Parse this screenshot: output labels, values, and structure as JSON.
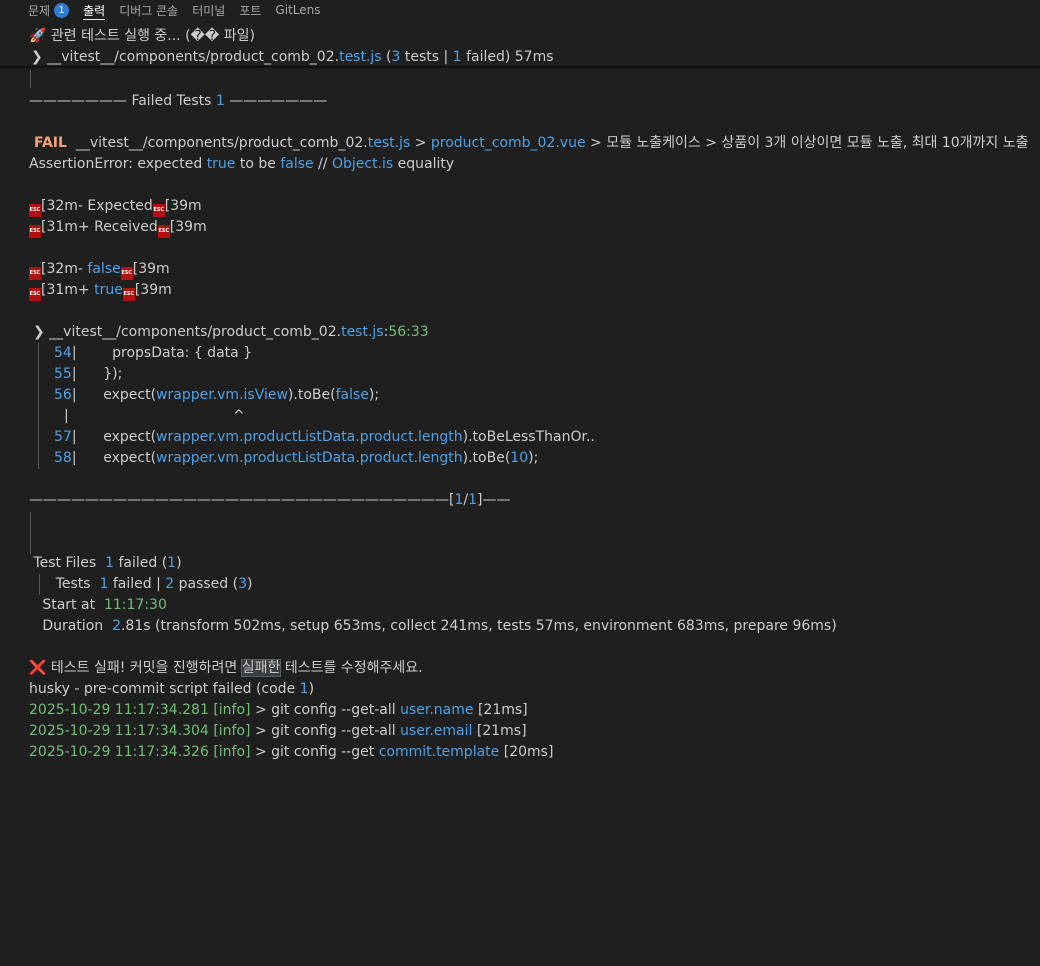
{
  "tabs": [
    {
      "label": "문제",
      "badge": "1"
    },
    {
      "label": "출력"
    },
    {
      "label": "디버그 콘솔"
    },
    {
      "label": "터미널"
    },
    {
      "label": "포트"
    },
    {
      "label": "GitLens"
    }
  ],
  "header": {
    "rocket": "🚀",
    "running": "관련 테스트 실행 중... (�� 파일)",
    "chevron": "❯",
    "file_prefix": "__vitest__/components/product_comb_02.",
    "file_ext": "test.js",
    "open_paren": " (",
    "tests_num": "3",
    "tests_mid": " tests | ",
    "failed_num": "1",
    "tail": " failed) 57ms"
  },
  "failed_header": {
    "left": "——————— Failed Tests ",
    "count": "1",
    "right": " ———————"
  },
  "fail_line": {
    "tag": "FAIL",
    "path": "  __vitest__/components/product_comb_02.",
    "ext": "test.js",
    "sep1": " > ",
    "vue": "product_comb_02.vue",
    "rest": " > 모듈 노출케이스 > 상품이 3개 이상이면 모듈 노출, 최대 10개까지 노출"
  },
  "assertion": {
    "a": "AssertionError: expected ",
    "b": "true",
    "c": " to be ",
    "d": "false",
    "e": " // ",
    "f": "Object.is",
    "g": " equality"
  },
  "esc_glyph": "ESC",
  "diff": {
    "l1a": "[32m- Expected",
    "l1b": "[39m",
    "l2a": "[31m+ Received",
    "l2b": "[39m",
    "l3a": "[32m- ",
    "l3v": "false",
    "l3b": "[39m",
    "l4a": "[31m+ ",
    "l4v": "true",
    "l4b": "[39m"
  },
  "location": {
    "chevron": "❯",
    "path": " __vitest__/components/product_comb_02.",
    "ext": "test.js",
    "colon": ":",
    "pos": "56:33"
  },
  "code": [
    {
      "num": "54",
      "text": "|        propsData: { data }"
    },
    {
      "num": "55",
      "text": "|      });"
    },
    {
      "num": "56",
      "pre": "|      expect(",
      "call": "wrapper.vm.isView",
      "mid": ").toBe(",
      "arg": "false",
      "post": ");"
    },
    {
      "caret_bar": "|",
      "caret": "^"
    },
    {
      "num": "57",
      "pre": "|      expect(",
      "call": "wrapper.vm.productListData.product.length",
      "post": ").toBeLessThanOr.."
    },
    {
      "num": "58",
      "pre": "|      expect(",
      "call": "wrapper.vm.productListData.product.length",
      "mid": ").toBe(",
      "arg": "10",
      "post": ");"
    }
  ],
  "separator": {
    "line": "——————————————————————————————[",
    "page": "1",
    "slash": "/",
    "total": "1",
    "end": "]——"
  },
  "summary": {
    "files_label": " Test Files  ",
    "files_failed": "1",
    "files_failed_txt": " failed (",
    "files_total": "1",
    "close": ")",
    "tests_label": "      Tests  ",
    "tests_failed": "1",
    "tests_mid": " failed | ",
    "tests_passed": "2",
    "tests_passed_txt": " passed (",
    "tests_total": "3",
    "start_label": "   Start at  ",
    "start_time": "11:17:30",
    "duration_label": "   Duration  ",
    "duration_num": "2",
    "duration_rest": ".81s (transform 502ms, setup 653ms, collect 241ms, tests 57ms, environment 683ms, prepare 96ms)"
  },
  "message": {
    "cross": "❌",
    "a": " 테스트 실패! 커밋을 진행하려면 ",
    "hl": "실패한",
    "b": " 테스트를 수정해주세요."
  },
  "husky": {
    "a": "husky - pre-commit script failed (code ",
    "code": "1",
    "b": ")"
  },
  "logs": [
    {
      "time": "2025-10-29 11:17:34.281",
      "level": "[info]",
      "cmd": " > git config --get-all ",
      "key": "user.name",
      "dur": " [21ms]"
    },
    {
      "time": "2025-10-29 11:17:34.304",
      "level": "[info]",
      "cmd": " > git config --get-all ",
      "key": "user.email",
      "dur": " [21ms]"
    },
    {
      "time": "2025-10-29 11:17:34.326",
      "level": "[info]",
      "cmd": " > git config --get ",
      "key": "commit.template",
      "dur": " [20ms]"
    }
  ]
}
